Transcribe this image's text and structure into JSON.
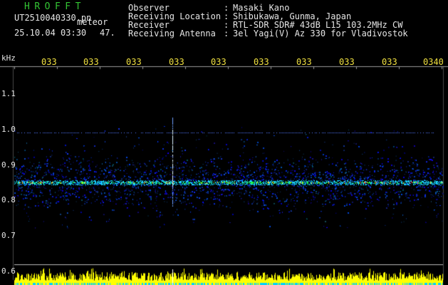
{
  "header": {
    "app_title": "HROFFT",
    "filename": "UT2510040330.pn",
    "mode": "meteor",
    "datetime": "25.10.04 03:30",
    "count": "47."
  },
  "station_info": [
    {
      "label": "Observer",
      "value": "Masaki Kano"
    },
    {
      "label": "Receiving Location",
      "value": "Shibukawa, Gunma, Japan"
    },
    {
      "label": "Receiver",
      "value": "RTL-SDR SDR# 43dB L15 103.2MHz CW"
    },
    {
      "label": "Receiving Antenna",
      "value": "3el Yagi(V) Az 330 for Vladivostok"
    }
  ],
  "separator": ":",
  "axis": {
    "unit": "kHz",
    "y_ticks": [
      "1.1",
      "1.0",
      "0.9",
      "0.8",
      "0.7",
      "0.6"
    ],
    "x_ticks": [
      "033",
      "033",
      "033",
      "033",
      "033",
      "033",
      "033",
      "033",
      "033",
      "0340"
    ]
  },
  "colors": {
    "background": "#000000",
    "title": "#34c534",
    "text": "#e6e6e6",
    "time_ticks": "#f0e040",
    "noise_band": "#1c3cff",
    "carrier_line": "#18d8ff",
    "carrier_hot": "#ff3020",
    "signal_bar": "#ffff00",
    "signal_low": "#00d0ff"
  }
}
